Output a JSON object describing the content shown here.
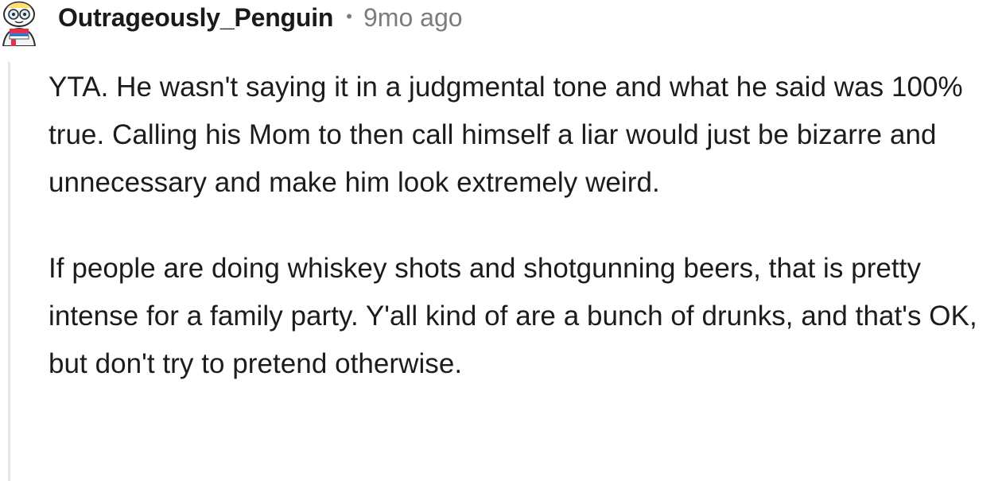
{
  "comment": {
    "username": "Outrageously_Penguin",
    "separator": "•",
    "timestamp": "9mo ago",
    "paragraphs": [
      "YTA. He wasn't saying it in a judgmental tone and what he said was 100% true. Calling his Mom to then call himself a liar would just be bizarre and unnecessary and make him look extremely weird.",
      "If people are doing whiskey shots and shotgunning beers, that is pretty intense for a family party. Y'all kind of are a bunch of drunks, and that's OK, but don't try to pretend otherwise."
    ]
  },
  "avatar": {
    "icon": "snoo-avatar-icon"
  },
  "colors": {
    "username": "#1a1a1b",
    "meta_gray": "#7c7c7c",
    "body_text": "#1c1c1c",
    "thread_line": "#e5e5e5"
  }
}
